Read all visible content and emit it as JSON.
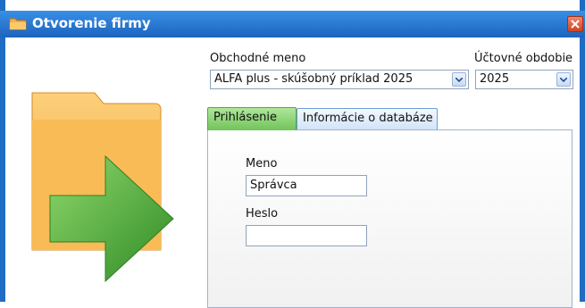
{
  "window": {
    "title": "Otvorenie firmy"
  },
  "icons": {
    "title": "folder-icon",
    "close": "close-icon",
    "hero": "folder-arrow-icon",
    "dropdown": "chevron-down-icon"
  },
  "colors": {
    "titlebar": "#2a78d4",
    "tab_active": "#8fd678",
    "close": "#e35a36",
    "arrow": "#4aa73a",
    "folder": "#f6b14a"
  },
  "company": {
    "label": "Obchodné meno",
    "value": "ALFA plus - skúšobný príklad 2025"
  },
  "period": {
    "label": "Účtovné obdobie",
    "value": "2025"
  },
  "tabs": [
    {
      "label": "Prihlásenie",
      "active": true
    },
    {
      "label": "Informácie o databáze",
      "active": false
    }
  ],
  "login": {
    "name_label": "Meno",
    "name_value": "Správca",
    "password_label": "Heslo",
    "password_value": ""
  }
}
